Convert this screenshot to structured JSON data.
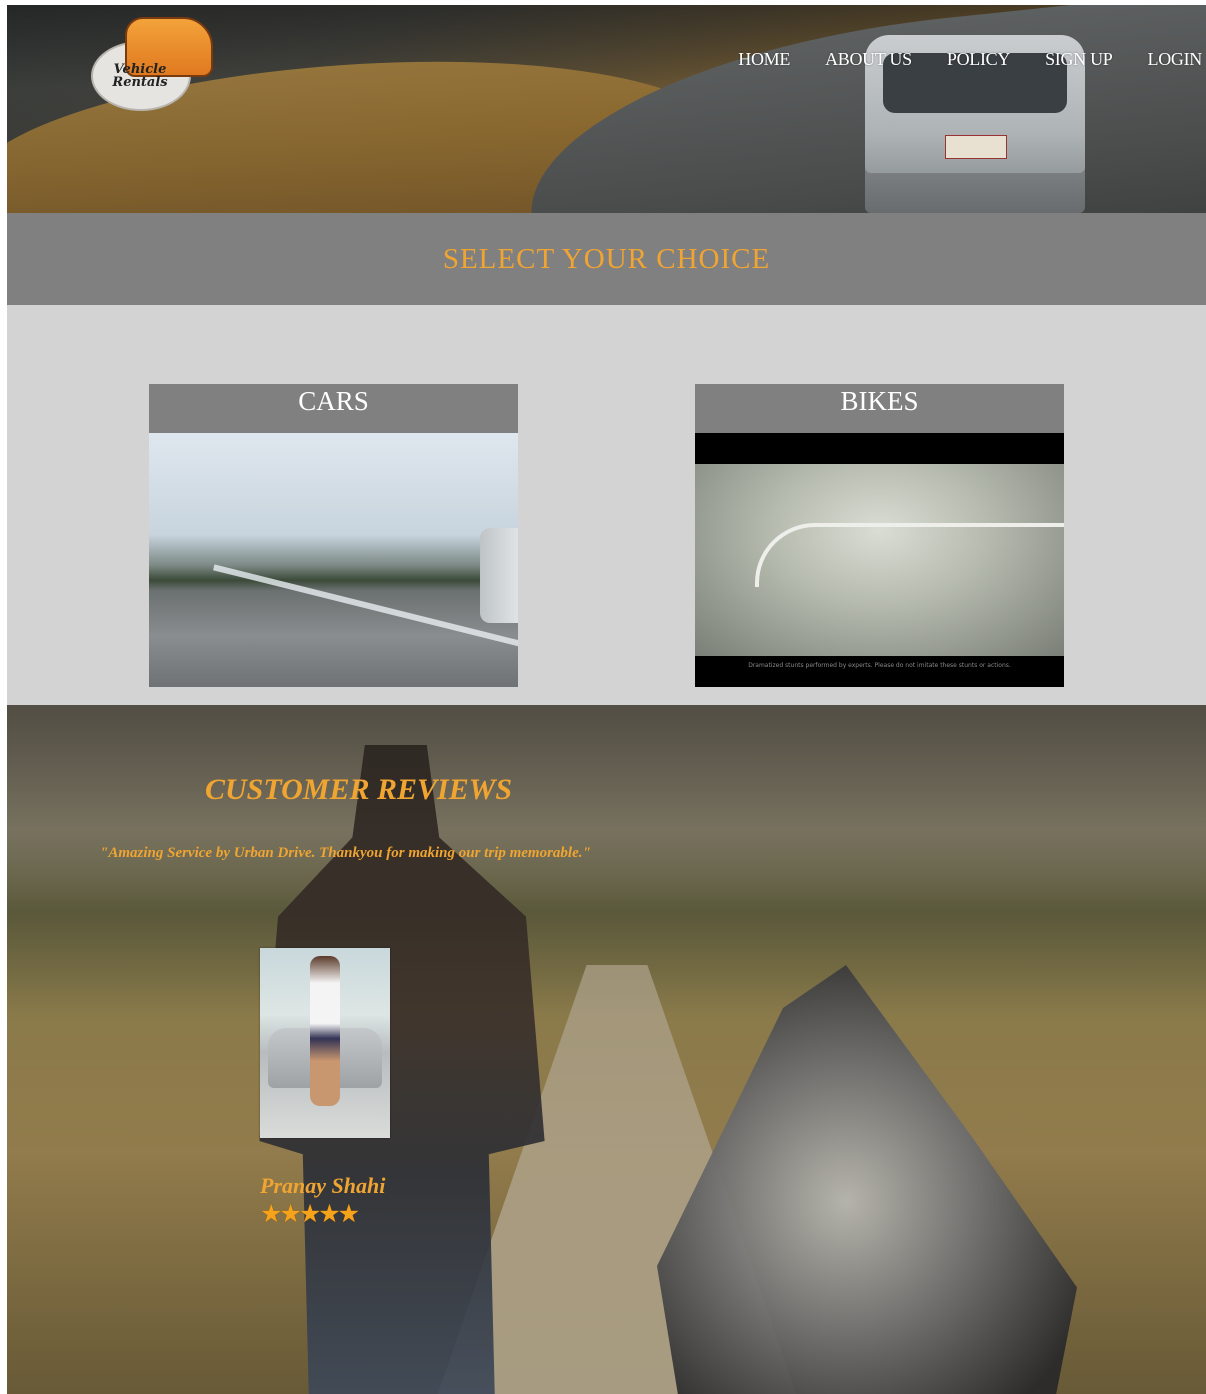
{
  "brand": {
    "logo_text": "Vehicle Rentals"
  },
  "nav": [
    {
      "label": "HOME"
    },
    {
      "label": "ABOUT US"
    },
    {
      "label": "POLICY"
    },
    {
      "label": "SIGN UP"
    },
    {
      "label": "LOGIN"
    }
  ],
  "choice": {
    "heading": "SELECT YOUR CHOICE"
  },
  "categories": [
    {
      "label": "CARS"
    },
    {
      "label": "BIKES",
      "caption": "Dramatized stunts performed by experts. Please do not imitate these stunts or actions."
    }
  ],
  "reviews": {
    "heading": "CUSTOMER REVIEWS",
    "quote": "\"Amazing Service by Urban Drive. Thankyou for making our trip memorable.\"",
    "reviewer": "Pranay Shahi",
    "rating": 5,
    "stars": "★★★★★"
  },
  "colors": {
    "accent": "#f0a431",
    "band": "#808080",
    "panel": "#d3d3d3"
  }
}
